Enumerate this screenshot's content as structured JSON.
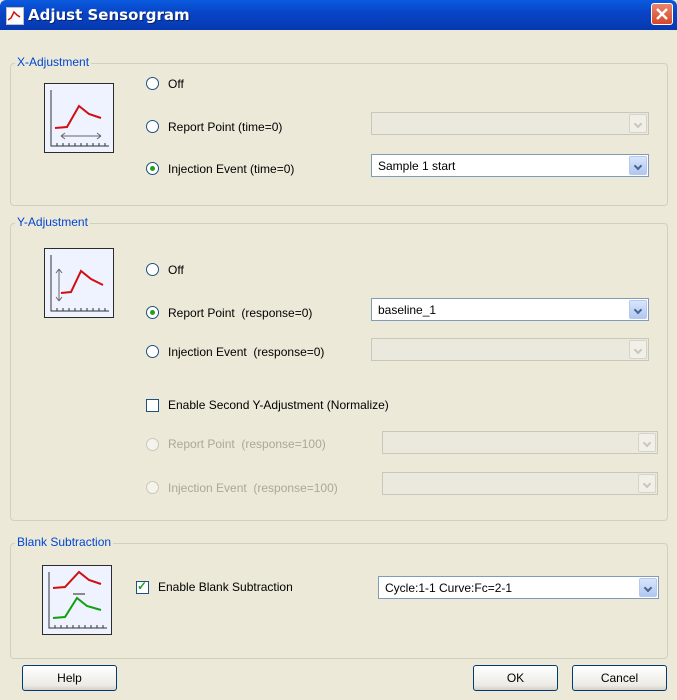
{
  "window": {
    "title": "Adjust Sensorgram",
    "icon": "sensorgram-icon",
    "close_icon": "close-icon"
  },
  "x_adjustment": {
    "legend": "X-Adjustment",
    "options": [
      {
        "label": "Off",
        "selected": false
      },
      {
        "label": "Report Point (time=0)",
        "selected": false
      },
      {
        "label": "Injection Event (time=0)",
        "selected": true
      }
    ],
    "report_point_combo": "",
    "injection_event_combo": "Sample 1 start"
  },
  "y_adjustment": {
    "legend": "Y-Adjustment",
    "options": [
      {
        "label": "Off",
        "selected": false
      },
      {
        "label": "Report Point  (response=0)",
        "selected": true
      },
      {
        "label": "Injection Event  (response=0)",
        "selected": false
      }
    ],
    "report_point_combo": "baseline_1",
    "injection_event_combo": "",
    "second": {
      "label": "Enable Second Y-Adjustment (Normalize)",
      "checked": false,
      "report_point_label": "Report Point  (response=100)",
      "injection_event_label": "Injection Event  (response=100)"
    }
  },
  "blank_subtraction": {
    "legend": "Blank Subtraction",
    "checkbox_label": "Enable Blank Subtraction",
    "checked": true,
    "combo": "Cycle:1-1   Curve:Fc=2-1"
  },
  "buttons": {
    "help": "Help",
    "ok": "OK",
    "cancel": "Cancel"
  },
  "colors": {
    "title_bar": "#0845c8",
    "legend": "#0046d5",
    "curve_red": "#d01010",
    "curve_green": "#10a010",
    "check_green": "#21a121"
  }
}
